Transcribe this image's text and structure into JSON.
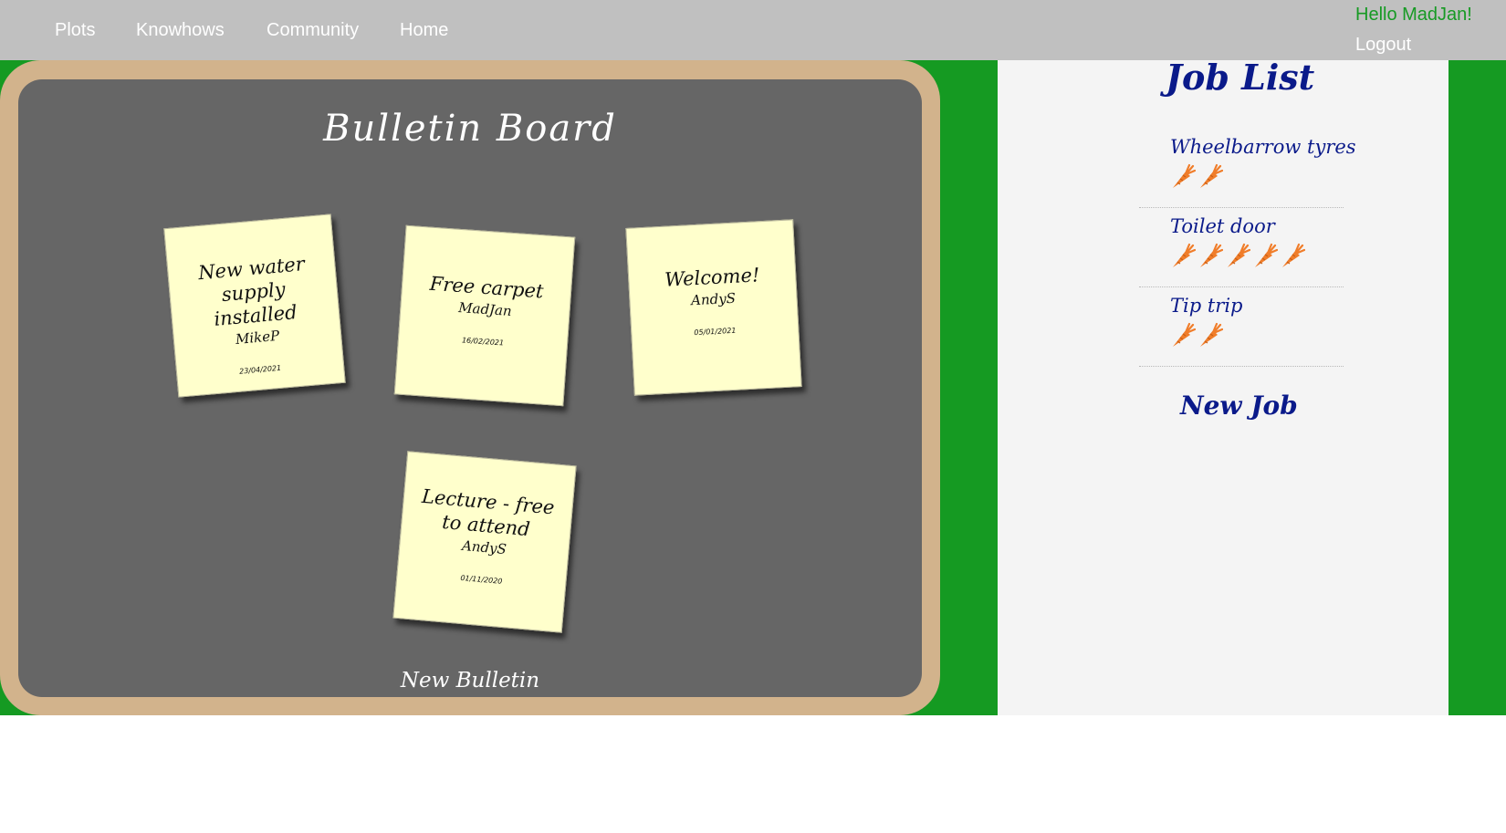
{
  "nav": {
    "items": [
      "Plots",
      "Knowhows",
      "Community",
      "Home"
    ],
    "greeting": "Hello MadJan!",
    "logout": "Logout"
  },
  "bulletin_board": {
    "title": "Bulletin Board",
    "notes": [
      {
        "title": "New water supply installed",
        "author": "MikeP",
        "date": "23/04/2021"
      },
      {
        "title": "Free carpet",
        "author": "MadJan",
        "date": "16/02/2021"
      },
      {
        "title": "Welcome!",
        "author": "AndyS",
        "date": "05/01/2021"
      },
      {
        "title": "Lecture - free to attend",
        "author": "AndyS",
        "date": "01/11/2020"
      }
    ],
    "new_bulletin_label": "New Bulletin"
  },
  "job_list": {
    "title": "Job List",
    "jobs": [
      {
        "name": "Wheelbarrow tyres",
        "carrots": 2
      },
      {
        "name": "Toilet door",
        "carrots": 5
      },
      {
        "name": "Tip trip",
        "carrots": 2
      }
    ],
    "new_job_label": "New Job",
    "carrot_icon": "carrot-icon"
  },
  "colors": {
    "topbar": "#c0c0c0",
    "greeting": "#179a24",
    "background_green": "#159a22",
    "board_frame": "#d2b38c",
    "board": "#666666",
    "note": "#ffffcc",
    "job_text": "#0a1a8a",
    "carrot": "#f07d2a"
  }
}
